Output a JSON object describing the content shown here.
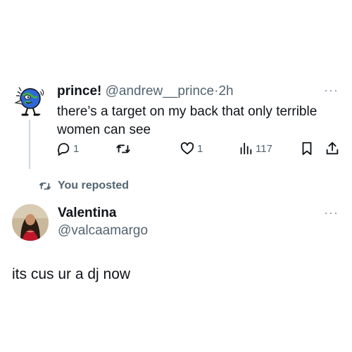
{
  "post": {
    "author_name": "prince!",
    "author_handle": "@andrew__prince",
    "separator": "·",
    "time": "2h",
    "text": "there’s a target on my back that only terrible women can see",
    "more_label": "···",
    "actions": {
      "reply_count": "1",
      "repost_count": "",
      "like_count": "1",
      "views_count": "117"
    }
  },
  "repost_banner": {
    "label": "You reposted"
  },
  "reply": {
    "author_name": "Valentina",
    "author_handle": "@valcaamargo",
    "more_label": "···",
    "text": "its cus ur a dj now"
  },
  "icons": {
    "reply": "reply-icon",
    "repost": "repost-icon",
    "like": "heart-icon",
    "views": "analytics-icon",
    "bookmark": "bookmark-icon",
    "share": "share-icon"
  },
  "colors": {
    "text": "#0f1419",
    "muted": "#536471",
    "thread_line": "#cfd9de"
  }
}
